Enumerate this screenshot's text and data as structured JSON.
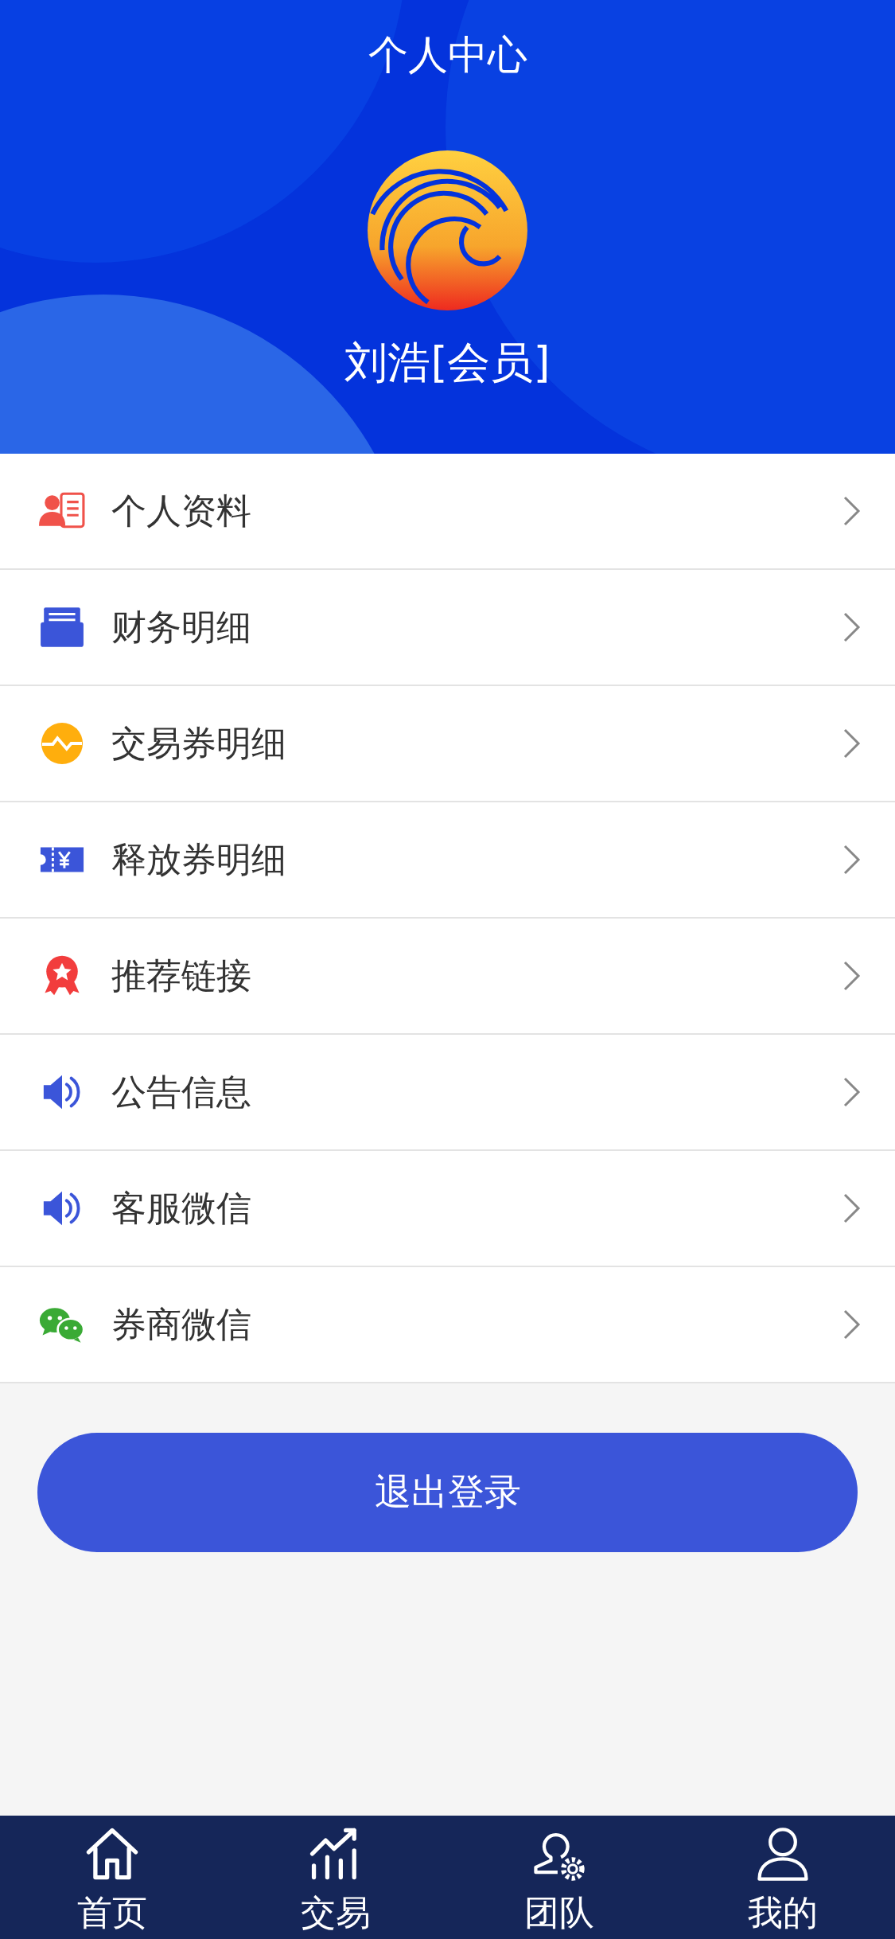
{
  "header": {
    "title": "个人中心",
    "user_name": "刘浩[会员]"
  },
  "menu": [
    {
      "kind": "profile",
      "label": "个人资料"
    },
    {
      "kind": "ledger",
      "label": "财务明细"
    },
    {
      "kind": "exchange",
      "label": "交易券明细"
    },
    {
      "kind": "ticket",
      "label": "释放券明细"
    },
    {
      "kind": "badge",
      "label": "推荐链接"
    },
    {
      "kind": "speaker",
      "label": "公告信息"
    },
    {
      "kind": "speaker",
      "label": "客服微信"
    },
    {
      "kind": "chat",
      "label": "券商微信"
    }
  ],
  "logout_button": "退出登录",
  "tab_bar": [
    {
      "kind": "home",
      "label": "首页"
    },
    {
      "kind": "chart",
      "label": "交易"
    },
    {
      "kind": "team",
      "label": "团队"
    },
    {
      "kind": "user",
      "label": "我的"
    }
  ]
}
